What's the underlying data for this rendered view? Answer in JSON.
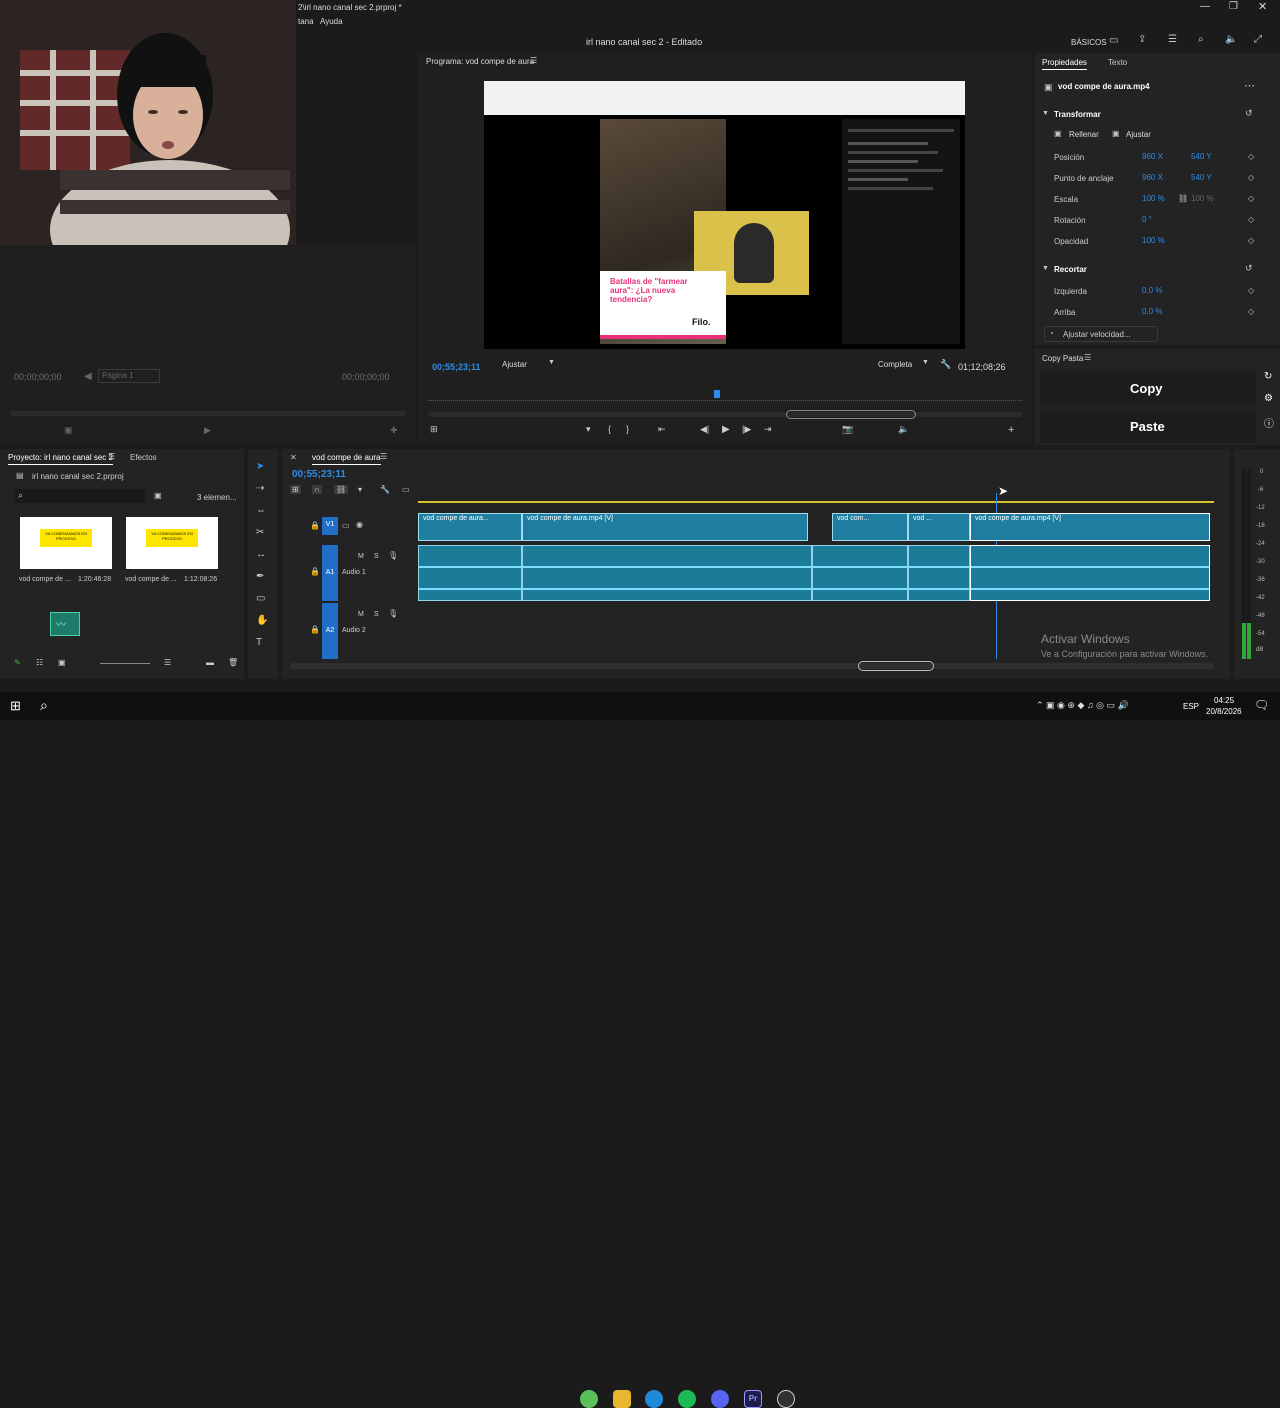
{
  "window": {
    "titlebar_path": "2\\irl nano canal sec 2.prproj *",
    "menu_items": [
      "tana",
      "Ayuda"
    ],
    "project_title": "irl nano canal sec 2 - Editado",
    "workspace": "BÁSICOS"
  },
  "source_monitor": {
    "timecode_left": "00;00;00;00",
    "page": "Página 1",
    "timecode_right": "00;00;00;00"
  },
  "program_monitor": {
    "title": "Programa: vod compe de aura",
    "timecode": "00;55;23;11",
    "fit": "Ajustar",
    "quality": "Completa",
    "duration": "01;12;08;26",
    "preview": {
      "caption_line1": "Batallas de \"farmear aura\": ¿La nueva tendencia?",
      "caption_brand": "Filo."
    }
  },
  "properties": {
    "tabs": [
      "Propiedades",
      "Texto"
    ],
    "clip_name": "vod compe de aura.mp4",
    "transform_label": "Transformar",
    "fill_label": "Rellenar",
    "fit_label": "Ajustar",
    "rows": [
      {
        "label": "Posición",
        "v1": "960 X",
        "v2": "540 Y"
      },
      {
        "label": "Punto de anclaje",
        "v1": "960 X",
        "v2": "540 Y"
      },
      {
        "label": "Escala",
        "v1": "100 %",
        "v2": "100 %"
      },
      {
        "label": "Rotación",
        "v1": "0 °",
        "v2": ""
      },
      {
        "label": "Opacidad",
        "v1": "100 %",
        "v2": ""
      }
    ],
    "crop_label": "Recortar",
    "crop_rows": [
      {
        "label": "Izquierda",
        "v1": "0,0 %"
      },
      {
        "label": "Arriba",
        "v1": "0,0 %"
      }
    ],
    "speed_button": "Ajustar velocidad..."
  },
  "copy_paste": {
    "title": "Copy Pasta",
    "copy": "Copy",
    "paste": "Paste"
  },
  "project_panel": {
    "tabs": [
      "Proyecto: irl nano canal sec 2",
      "Efectos"
    ],
    "file": "irl nano canal sec 2.prproj",
    "count": "3 elemen...",
    "items": [
      {
        "name": "vod compe de ...",
        "duration": "1:20:46:28",
        "thumb_text": "YA COMENZAMOS EN PROCESO"
      },
      {
        "name": "vod compe de ...",
        "duration": "1:12:08:26",
        "thumb_text": "YA COMENZAMOS EN PROCESO"
      }
    ]
  },
  "timeline": {
    "sequence": "vod compe de aura",
    "timecode": "00;55;23;11",
    "tracks": {
      "v1": "V1",
      "a1": "A1",
      "a1_name": "Audio 1",
      "a2": "A2",
      "a2_name": "Audio 2"
    },
    "clips_v": [
      "vod compe de aura...",
      "vod compe de aura.mp4 [V]",
      "vod com...",
      "vod ...",
      "vod compe de aura.mp4 [V]"
    ],
    "watermark_title": "Activar Windows",
    "watermark_sub": "Ve a Configuración para activar Windows."
  },
  "meter": {
    "labels": [
      "0",
      "-6",
      "-12",
      "-18",
      "-24",
      "-30",
      "-36",
      "-42",
      "-48",
      "-54",
      "dB"
    ]
  },
  "taskbar": {
    "lang": "ESP",
    "time": "04:25",
    "date": "20/8/2026"
  }
}
